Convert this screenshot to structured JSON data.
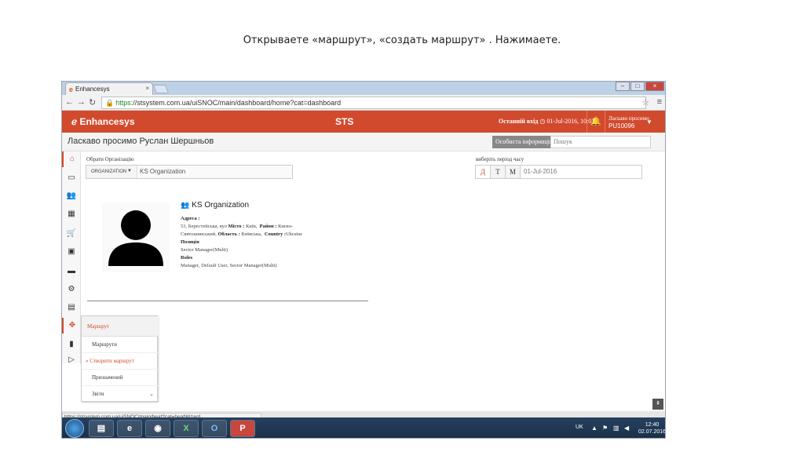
{
  "slide": {
    "caption": "Открываете «маршрут», «создать маршрут» . Нажимаете."
  },
  "browser": {
    "tab_title": "Enhancesys",
    "tab_close": "×",
    "url_scheme": "https",
    "url_rest": "://stsystem.com.ua/uiSNOC/main/dashboard/home?cat=dashboard",
    "status_url": "https://stsystem.com.ua/uiSNOC/main/beat?cat=beatWizard"
  },
  "header": {
    "brand": "Enhancesys",
    "title": "STS",
    "last_login_label": "Останній вхід",
    "last_login_value": "01-Jul-2016, 10:03",
    "welcome_label": "Ласкаво просимо",
    "user_id": "PU10096"
  },
  "greeting": {
    "text": "Ласкаво просимо Руслан Шершньов",
    "personal_info_button": "Особиста інформація",
    "search_placeholder": "Пошук"
  },
  "filters": {
    "org_label": "Обрати Організацію",
    "org_type": "ORGANIZATION",
    "org_value": "KS Organization",
    "period_label": "виберіть період часу",
    "period_buttons": [
      "Д",
      "Т",
      "М"
    ],
    "date_value": "01-Jul-2016"
  },
  "profile": {
    "org_name": "KS Organization",
    "address_label": "Адреса :",
    "address_line1": "53, Берестейська, вул",
    "city_label": "Місто :",
    "city": "Київ,",
    "district_label": "Район :",
    "district": "Києво-",
    "district2": "Святошинський,",
    "region_label": "Область :",
    "region": "Київська,",
    "country_label": "Country :",
    "country": "Ukraine",
    "position_label": "Позиція",
    "position": "Sector Manager(Multi)",
    "roles_label": "Roles",
    "roles": "Manager, Default User, Sector Manager(Multi)"
  },
  "route_menu": {
    "header": "Маршрут",
    "items": [
      {
        "label": "Маршрути",
        "active": false
      },
      {
        "label": "» Створити маршрут",
        "active": true
      },
      {
        "label": "Призначений",
        "active": false
      },
      {
        "label": "Звіти",
        "active": false,
        "chevron": "⌄"
      }
    ]
  },
  "taskbar": {
    "apps": [
      "explorer",
      "ie",
      "chrome",
      "excel",
      "outlook",
      "powerpoint"
    ],
    "lang": "UK",
    "time": "12:40",
    "date": "02.07.2016"
  },
  "colors": {
    "accent": "#d24a2d",
    "taskbar": "#1f3650"
  }
}
